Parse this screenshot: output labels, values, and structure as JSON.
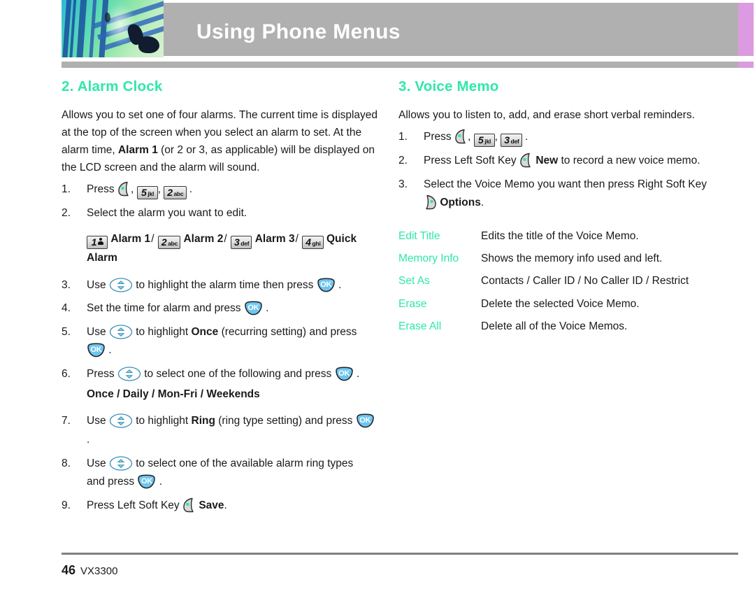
{
  "header": {
    "title": "Using Phone Menus",
    "bar_color": "#b0b0b0",
    "accent_color": "#dc9ae0",
    "photo_alt": "abstract-teal-blue-photo"
  },
  "left_column": {
    "section_title": "2. Alarm Clock",
    "intro_parts": {
      "p1": "Allows you to set one of four alarms. The current time is displayed at the top of the screen when you select an alarm to set. At the alarm time, ",
      "bold1": "Alarm 1",
      "p2": " (or 2 or 3, as applicable) will be displayed on the LCD screen and the alarm will sound."
    },
    "steps": {
      "s1_num": "1.",
      "s1_press": "Press",
      "s1_key_a": "softkey-left",
      "s1_key_b": {
        "digit": "5",
        "letters": "jkl"
      },
      "s1_key_c": {
        "digit": "2",
        "letters": "abc"
      },
      "s1_period": ".",
      "s2_num": "2.",
      "s2_text": "Select the alarm you want to edit.",
      "alarm_list": {
        "k1": {
          "digit": "1",
          "letters": "voicemail-icon"
        },
        "l1": "Alarm 1",
        "sep1": "/",
        "k2": {
          "digit": "2",
          "letters": "abc"
        },
        "l2": "Alarm 2",
        "sep2": "/",
        "k3": {
          "digit": "3",
          "letters": "def"
        },
        "l3": "Alarm 3",
        "sep3": "/",
        "k4": {
          "digit": "4",
          "letters": "ghi"
        },
        "l4": "Quick Alarm"
      },
      "s3_num": "3.",
      "s3_a": "Use",
      "s3_b": "to highlight the alarm time then press",
      "s3_c": ".",
      "s4_num": "4.",
      "s4_a": "Set the time for alarm and press",
      "s4_b": ".",
      "s5_num": "5.",
      "s5_a": "Use",
      "s5_b": "to highlight",
      "s5_bold": "Once",
      "s5_c": "(recurring setting) and press",
      "s5_d": ".",
      "s6_num": "6.",
      "s6_a": "Press",
      "s6_b": "to select one of the following and press",
      "s6_c": ".",
      "s6_options": "Once / Daily / Mon-Fri / Weekends",
      "s7_num": "7.",
      "s7_a": "Use",
      "s7_b": "to highlight",
      "s7_bold": "Ring",
      "s7_c": "(ring type setting) and press",
      "s7_d": ".",
      "s8_num": "8.",
      "s8_a": "Use",
      "s8_b": "to select one of the available alarm ring types",
      "s8_c": "and press",
      "s8_d": ".",
      "s9_num": "9.",
      "s9_a": "Press Left Soft Key",
      "s9_bold": "Save",
      "s9_b": "."
    }
  },
  "right_column": {
    "section_title": "3. Voice Memo",
    "intro": "Allows you to listen to, add, and erase short verbal reminders.",
    "steps": {
      "s1_num": "1.",
      "s1_press": "Press",
      "s1_key_b": {
        "digit": "5",
        "letters": "jkl"
      },
      "s1_key_c": {
        "digit": "3",
        "letters": "def"
      },
      "s1_period": ".",
      "s2_num": "2.",
      "s2_a": "Press Left Soft Key",
      "s2_bold": "New",
      "s2_b": "to record a new voice memo.",
      "s3_num": "3.",
      "s3_a": "Select the Voice Memo you want then press Right Soft Key",
      "s3_bold": "Options",
      "s3_b": "."
    },
    "options": [
      {
        "name": "Edit Title",
        "desc": "Edits the title of the Voice Memo."
      },
      {
        "name": "Memory Info",
        "desc": "Shows the memory info used and left."
      },
      {
        "name": "Set As",
        "desc": "Contacts / Caller ID / No Caller ID / Restrict"
      },
      {
        "name": "Erase",
        "desc": "Delete the selected Voice Memo."
      },
      {
        "name": "Erase All",
        "desc": "Delete all of the Voice Memos."
      }
    ]
  },
  "footer": {
    "page_number": "46",
    "model": "VX3300"
  },
  "colors": {
    "accent_green": "#2fe8a8",
    "header_gray": "#b0b0b0",
    "purple": "#dc9ae0",
    "ok_blue": "#6ec6f0",
    "softkey_dot": "#2fe8a8"
  }
}
